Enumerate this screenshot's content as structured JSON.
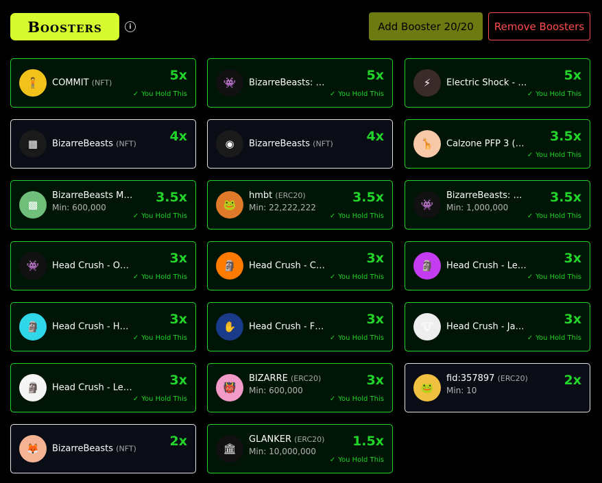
{
  "header": {
    "title": "Boosters",
    "add_button": "Add Booster 20/20",
    "remove_button": "Remove Boosters",
    "info_glyph": "i"
  },
  "colors": {
    "accent_lime": "#d6fb2e",
    "held_green": "#21d52a",
    "remove_red": "#ff4d4d"
  },
  "boosters": [
    {
      "name": "COMMIT",
      "tag": "(NFT)",
      "min": "",
      "mult": "5x",
      "hold": "You Hold This",
      "held": true,
      "icon": "pink-figure-icon",
      "glyph": "🧍",
      "bg": "#f2c21b"
    },
    {
      "name": "BizarreBeasts: …",
      "tag": "",
      "min": "",
      "mult": "5x",
      "hold": "You Hold This",
      "held": true,
      "icon": "beasts-grid-icon",
      "glyph": "👾",
      "bg": "#111111"
    },
    {
      "name": "Electric Shock - …",
      "tag": "",
      "min": "",
      "mult": "5x",
      "hold": "You Hold This",
      "held": true,
      "icon": "electric-face-icon",
      "glyph": "⚡",
      "bg": "#3a2a2a"
    },
    {
      "name": "BizarreBeasts",
      "tag": "(NFT)",
      "min": "",
      "mult": "4x",
      "hold": "",
      "held": false,
      "icon": "beasts-banner-icon",
      "glyph": "▦",
      "bg": "#1a1a1a"
    },
    {
      "name": "BizarreBeasts",
      "tag": "(NFT)",
      "min": "",
      "mult": "4x",
      "hold": "",
      "held": false,
      "icon": "beasts-banner-icon",
      "glyph": "◉",
      "bg": "#1a1a1a"
    },
    {
      "name": "Calzone PFP 3 (…",
      "tag": "",
      "min": "",
      "mult": "3.5x",
      "hold": "You Hold This",
      "held": true,
      "icon": "calzone-icon",
      "glyph": "🦒",
      "bg": "#f8c9a8"
    },
    {
      "name": "BizarreBeasts M…",
      "tag": "",
      "min": "Min: 600,000",
      "mult": "3.5x",
      "hold": "You Hold This",
      "held": true,
      "icon": "colorful-grid-icon",
      "glyph": "▩",
      "bg": "#6fbf7a"
    },
    {
      "name": "hmbt",
      "tag": "(ERC20)",
      "min": "Min: 22,222,222",
      "mult": "3.5x",
      "hold": "You Hold This",
      "held": true,
      "icon": "green-creature-icon",
      "glyph": "🐸",
      "bg": "#e07a2a"
    },
    {
      "name": "BizarreBeasts: …",
      "tag": "",
      "min": "Min: 1,000,000",
      "mult": "3.5x",
      "hold": "You Hold This",
      "held": true,
      "icon": "head-crush-grid-icon",
      "glyph": "👾",
      "bg": "#111111"
    },
    {
      "name": "Head Crush - O…",
      "tag": "",
      "min": "",
      "mult": "3x",
      "hold": "You Hold This",
      "held": true,
      "icon": "head-crush-grid-icon",
      "glyph": "👾",
      "bg": "#111111"
    },
    {
      "name": "Head Crush - C…",
      "tag": "",
      "min": "",
      "mult": "3x",
      "hold": "You Hold This",
      "held": true,
      "icon": "orange-head-icon",
      "glyph": "🗿",
      "bg": "#ff7a00"
    },
    {
      "name": "Head Crush - Le…",
      "tag": "",
      "min": "",
      "mult": "3x",
      "hold": "You Hold This",
      "held": true,
      "icon": "purple-head-icon",
      "glyph": "🗿",
      "bg": "#c43cf0"
    },
    {
      "name": "Head Crush - H…",
      "tag": "",
      "min": "",
      "mult": "3x",
      "hold": "You Hold This",
      "held": true,
      "icon": "cyan-head-icon",
      "glyph": "🗿",
      "bg": "#2fd7e8"
    },
    {
      "name": "Head Crush - F…",
      "tag": "",
      "min": "",
      "mult": "3x",
      "hold": "You Hold This",
      "held": true,
      "icon": "blue-hand-icon",
      "glyph": "✋",
      "bg": "#1a3a8a"
    },
    {
      "name": "Head Crush - Ja…",
      "tag": "",
      "min": "",
      "mult": "3x",
      "hold": "You Hold This",
      "held": true,
      "icon": "cow-head-icon",
      "glyph": "🐮",
      "bg": "#eeeeee"
    },
    {
      "name": "Head Crush - Le…",
      "tag": "",
      "min": "",
      "mult": "3x",
      "hold": "You Hold This",
      "held": true,
      "icon": "white-head-icon",
      "glyph": "🗿",
      "bg": "#f5f5f5"
    },
    {
      "name": "BIZARRE",
      "tag": "(ERC20)",
      "min": "Min: 600,000",
      "mult": "3x",
      "hold": "You Hold This",
      "held": true,
      "icon": "bizarre-token-icon",
      "glyph": "👹",
      "bg": "#f29ac8"
    },
    {
      "name": "fid:357897",
      "tag": "(ERC20)",
      "min": "Min: 10",
      "mult": "2x",
      "hold": "",
      "held": false,
      "icon": "frog-token-icon",
      "glyph": "🐸",
      "bg": "#f0c040"
    },
    {
      "name": "BizarreBeasts",
      "tag": "(NFT)",
      "min": "",
      "mult": "2x",
      "hold": "",
      "held": false,
      "icon": "fox-art-icon",
      "glyph": "🦊",
      "bg": "#f6b394"
    },
    {
      "name": "GLANKER",
      "tag": "(ERC20)",
      "min": "Min: 10,000,000",
      "mult": "1.5x",
      "hold": "You Hold This",
      "held": true,
      "icon": "bank-icon",
      "glyph": "🏛",
      "bg": "#111111"
    }
  ]
}
